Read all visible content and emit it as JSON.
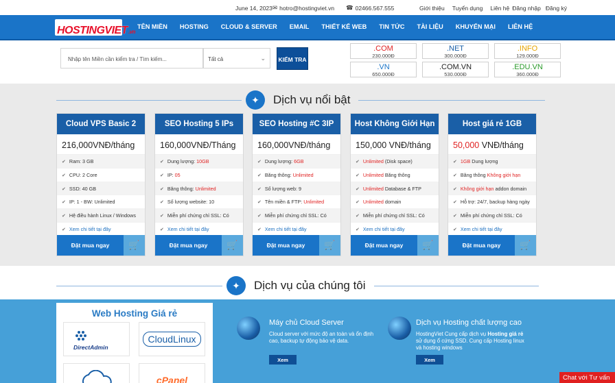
{
  "topbar": {
    "date": "June 14, 2023",
    "email": "hotro@hostingviet.vn",
    "phone": "02466.567.555",
    "links": [
      "Giới thiệu",
      "Tuyển dụng",
      "Liên hệ",
      "Đăng nhập",
      "Đăng ký"
    ]
  },
  "logo": {
    "main": "HOSTINGVIET",
    "suffix": ".vn"
  },
  "nav": [
    "TÊN MIỀN",
    "HOSTING",
    "CLOUD & SERVER",
    "EMAIL",
    "THIẾT KẾ WEB",
    "TIN TỨC",
    "TÀI LIỆU",
    "KHUYẾN MẠI",
    "LIÊN HỆ"
  ],
  "search": {
    "placeholder": "Nhập tên Miền cần kiểm tra / Tìm kiếm...",
    "select_value": "Tất cả",
    "button": "KIỂM TRA"
  },
  "domains": [
    {
      "ext": ".COM",
      "price": "230.000Đ",
      "color": "#e02222"
    },
    {
      "ext": ".NET",
      "price": "300.000Đ",
      "color": "#1a5fa7"
    },
    {
      "ext": ".INFO",
      "price": "129.000Đ",
      "color": "#e8a400"
    },
    {
      "ext": ".VN",
      "price": "650.000Đ",
      "color": "#1a74c8"
    },
    {
      "ext": ".COM.VN",
      "price": "530.000Đ",
      "color": "#222222"
    },
    {
      "ext": ".EDU.VN",
      "price": "360.000Đ",
      "color": "#2a9a2a"
    }
  ],
  "featured": {
    "title": "Dịch vụ nổi bật",
    "cards": [
      {
        "title": "Cloud VPS Basic 2",
        "price": "216,000VNĐ/tháng",
        "features": [
          "Ram: 3 GB",
          "CPU: 2 Core",
          "SSD: 40 GB",
          "IP: 1  -  BW: Unlimited",
          "Hệ điều hành Linux / Windows"
        ],
        "more": "Xem chi tiết tại đây",
        "buy": "Đặt mua ngay"
      },
      {
        "title": "SEO Hosting 5 IPs",
        "price": "160,000VNĐ/Tháng",
        "features": [
          "Dung lượng: 10GB",
          "IP: 05",
          "Băng thông: Unlimited",
          "Số lượng website: 10",
          "Miễn phí chứng chỉ SSL: Có"
        ],
        "more": "Xem chi tiết tại đây",
        "buy": "Đặt mua ngay"
      },
      {
        "title": "SEO Hosting #C 3IP",
        "price": "160,000VNĐ/tháng",
        "features": [
          "Dung lượng: 6GB",
          "Băng thông: Unlimited",
          "Số lượng web: 9",
          "Tên miền & FTP: Unlimited",
          "Miễn phí chứng chỉ SSL: Có"
        ],
        "more": "Xem chi tiết tại đây",
        "buy": "Đặt mua ngay"
      },
      {
        "title": "Host Không Giới Hạn",
        "price": "150,000 VNĐ/tháng",
        "features": [
          "Unlimited (Disk space)",
          "Unlimited Băng thông",
          "Unlimited Database &  FTP",
          "Unlimited domain",
          "Miễn phí chứng chỉ SSL: Có"
        ],
        "more": "Xem chi tiết tại đây",
        "buy": "Đặt mua ngay"
      },
      {
        "title": "Host giá rẻ 1GB",
        "price_red": "50,000",
        "price_rest": " VNĐ/tháng",
        "features": [
          "1GB Dung lượng",
          "Băng thông Không giới hạn",
          "Không giới hạn addon domain",
          "Hỗ trợ: 24/7, backup hàng ngày",
          "Miễn phí chứng chỉ SSL: Có"
        ],
        "more": "Xem chi tiết tại đây",
        "buy": "Đặt mua ngay"
      }
    ]
  },
  "services": {
    "title": "Dịch vụ của chúng tôi",
    "webhosting": {
      "title": "Web Hosting Giá rẻ",
      "logos": [
        "DirectAdmin",
        "CloudLinux",
        "cPanel"
      ]
    },
    "cloud": {
      "title": "Máy chủ Cloud Server",
      "desc": "Cloud server với mức độ an toàn và ổn định cao, backup tự động bảo vệ data.",
      "button": "Xem"
    },
    "quality": {
      "title": "Dịch vụ Hosting chất lượng cao",
      "desc_1": "HostingViet Cung cấp dịch vụ ",
      "desc_bold": "Hosting giá rẻ",
      "desc_2": " sử dụng ổ cứng SSD. Cung cấp Hosting linux và hosting windows",
      "button": "Xem"
    }
  },
  "chat": "Chat với Tư vấn"
}
